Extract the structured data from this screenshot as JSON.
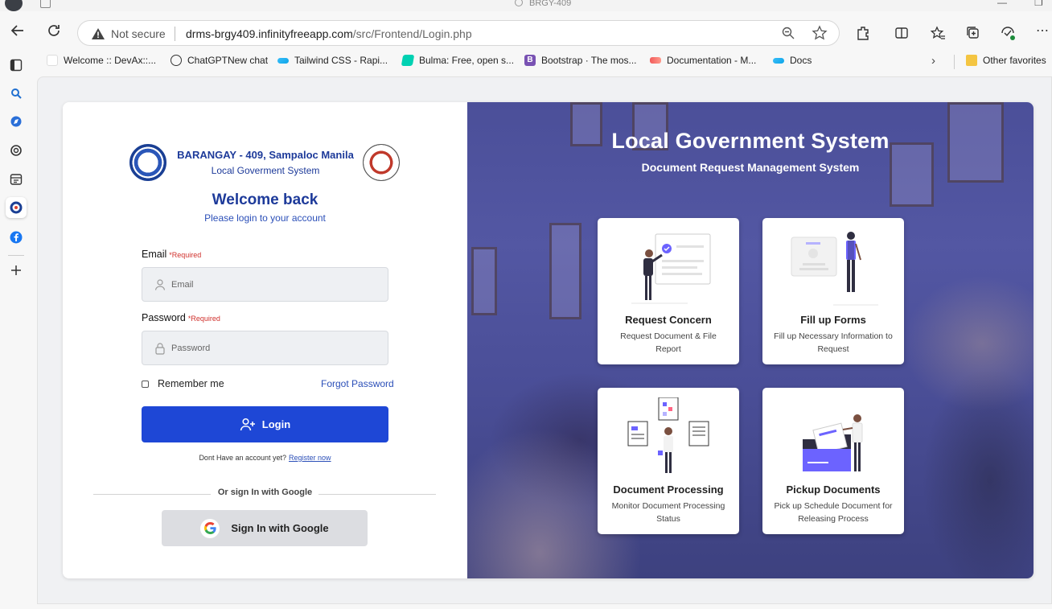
{
  "browser": {
    "window_title": "BRGY-409",
    "security_label": "Not secure",
    "url_domain": "drms-brgy409.infinityfreeapp.com",
    "url_path": "/src/Frontend/Login.php",
    "bookmarks": [
      {
        "label": "Welcome :: DevAx::..."
      },
      {
        "label": "ChatGPTNew chat"
      },
      {
        "label": "Tailwind CSS - Rapi..."
      },
      {
        "label": "Bulma: Free, open s..."
      },
      {
        "label": "Bootstrap · The mos..."
      },
      {
        "label": "Documentation - M..."
      },
      {
        "label": "Docs"
      }
    ],
    "other_favorites": "Other favorites"
  },
  "login": {
    "barangay_name": "BARANGAY - 409, Sampaloc Manila",
    "system_name": "Local Goverment System",
    "welcome": "Welcome back",
    "welcome_sub": "Please login to your account",
    "email_label": "Email",
    "password_label": "Password",
    "required": "*Required",
    "email_placeholder": "Email",
    "password_placeholder": "Password",
    "remember": "Remember me",
    "forgot": "Forgot Password",
    "login_button": "Login",
    "no_account": "Dont Have an account yet?",
    "register": "Register now",
    "or_google": "Or sign In with Google",
    "google_button": "Sign In with Google"
  },
  "hero": {
    "title": "Local Government System",
    "subtitle": "Document Request Management System",
    "features": [
      {
        "title": "Request Concern",
        "desc": "Request Document & File Report"
      },
      {
        "title": "Fill up Forms",
        "desc": "Fill up Necessary Information to Request"
      },
      {
        "title": "Document Processing",
        "desc": "Monitor Document Processing Status"
      },
      {
        "title": "Pickup Documents",
        "desc": "Pick up Schedule Document for Releasing Process"
      }
    ]
  },
  "colors": {
    "primary": "#1e47d6",
    "heading": "#1d3a9a",
    "required": "#d0312d",
    "hero_overlay": "#4b4f99"
  }
}
